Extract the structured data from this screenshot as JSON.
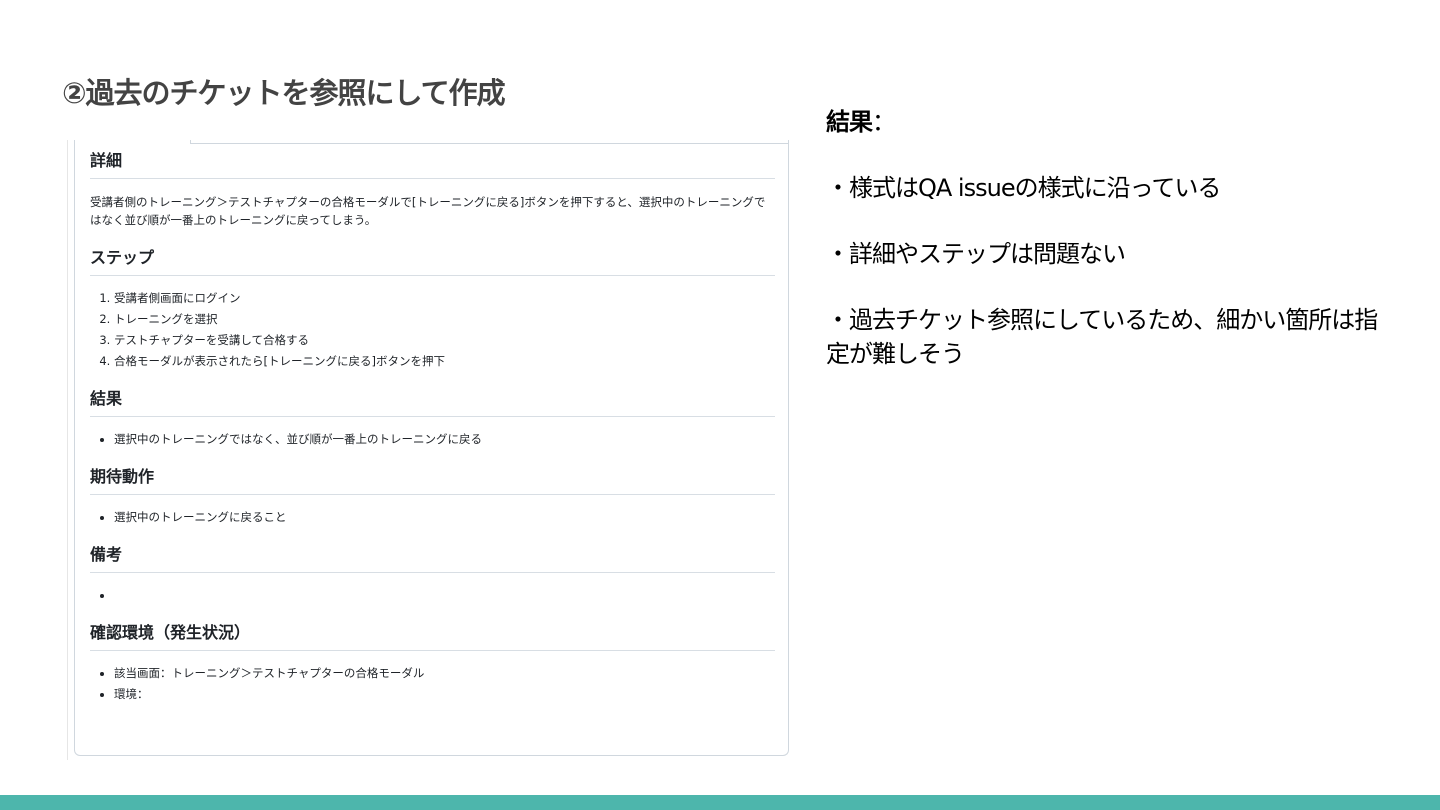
{
  "slide": {
    "title": "②過去のチケットを参照にして作成",
    "accent_color": "#4db6ac"
  },
  "issue": {
    "details_heading": "詳細",
    "details_text": "受講者側のトレーニング＞テストチャプターの合格モーダルで[トレーニングに戻る]ボタンを押下すると、選択中のトレーニングではなく並び順が一番上のトレーニングに戻ってしまう。",
    "steps_heading": "ステップ",
    "steps": [
      "受講者側画面にログイン",
      "トレーニングを選択",
      "テストチャプターを受講して合格する",
      "合格モーダルが表示されたら[トレーニングに戻る]ボタンを押下"
    ],
    "result_heading": "結果",
    "result_items": [
      "選択中のトレーニングではなく、並び順が一番上のトレーニングに戻る"
    ],
    "expected_heading": "期待動作",
    "expected_items": [
      "選択中のトレーニングに戻ること"
    ],
    "notes_heading": "備考",
    "notes_items": [
      ""
    ],
    "env_heading": "確認環境（発生状況）",
    "env_items": [
      "該当画面：トレーニング＞テストチャプターの合格モーダル",
      "環境："
    ]
  },
  "result_panel": {
    "heading": "結果",
    "colon": "：",
    "points": [
      "・様式はQA issueの様式に沿っている",
      "・詳細やステップは問題ない",
      "・過去チケット参照にしているため、細かい箇所は指定が難しそう"
    ]
  }
}
